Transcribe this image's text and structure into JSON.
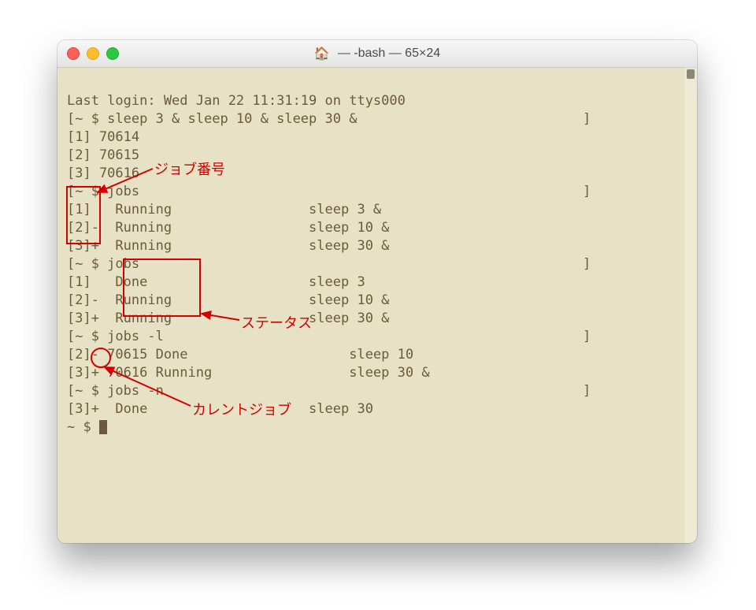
{
  "window": {
    "title": "— -bash — 65×24"
  },
  "lines": {
    "l0": "Last login: Wed Jan 22 11:31:19 on ttys000",
    "l1": "[~ $ sleep 3 & sleep 10 & sleep 30 &                            ]",
    "l2": "[1] 70614",
    "l3": "[2] 70615",
    "l4": "[3] 70616",
    "l5": "[~ $ jobs                                                       ]",
    "l6": "[1]   Running                 sleep 3 &",
    "l7": "[2]-  Running                 sleep 10 &",
    "l8": "[3]+  Running                 sleep 30 &",
    "l9": "[~ $ jobs                                                       ]",
    "l10": "[1]   Done                    sleep 3",
    "l11": "[2]-  Running                 sleep 10 &",
    "l12": "[3]+  Running                 sleep 30 &",
    "l13": "[~ $ jobs -l                                                    ]",
    "l14": "[2]- 70615 Done                    sleep 10",
    "l15": "[3]+ 70616 Running                 sleep 30 &",
    "l16": "[~ $ jobs -n                                                    ]",
    "l17": "[3]+  Done                    sleep 30",
    "l18": "~ $ "
  },
  "annotations": {
    "job_number": "ジョブ番号",
    "status": "ステータス",
    "current_job": "カレントジョブ"
  }
}
